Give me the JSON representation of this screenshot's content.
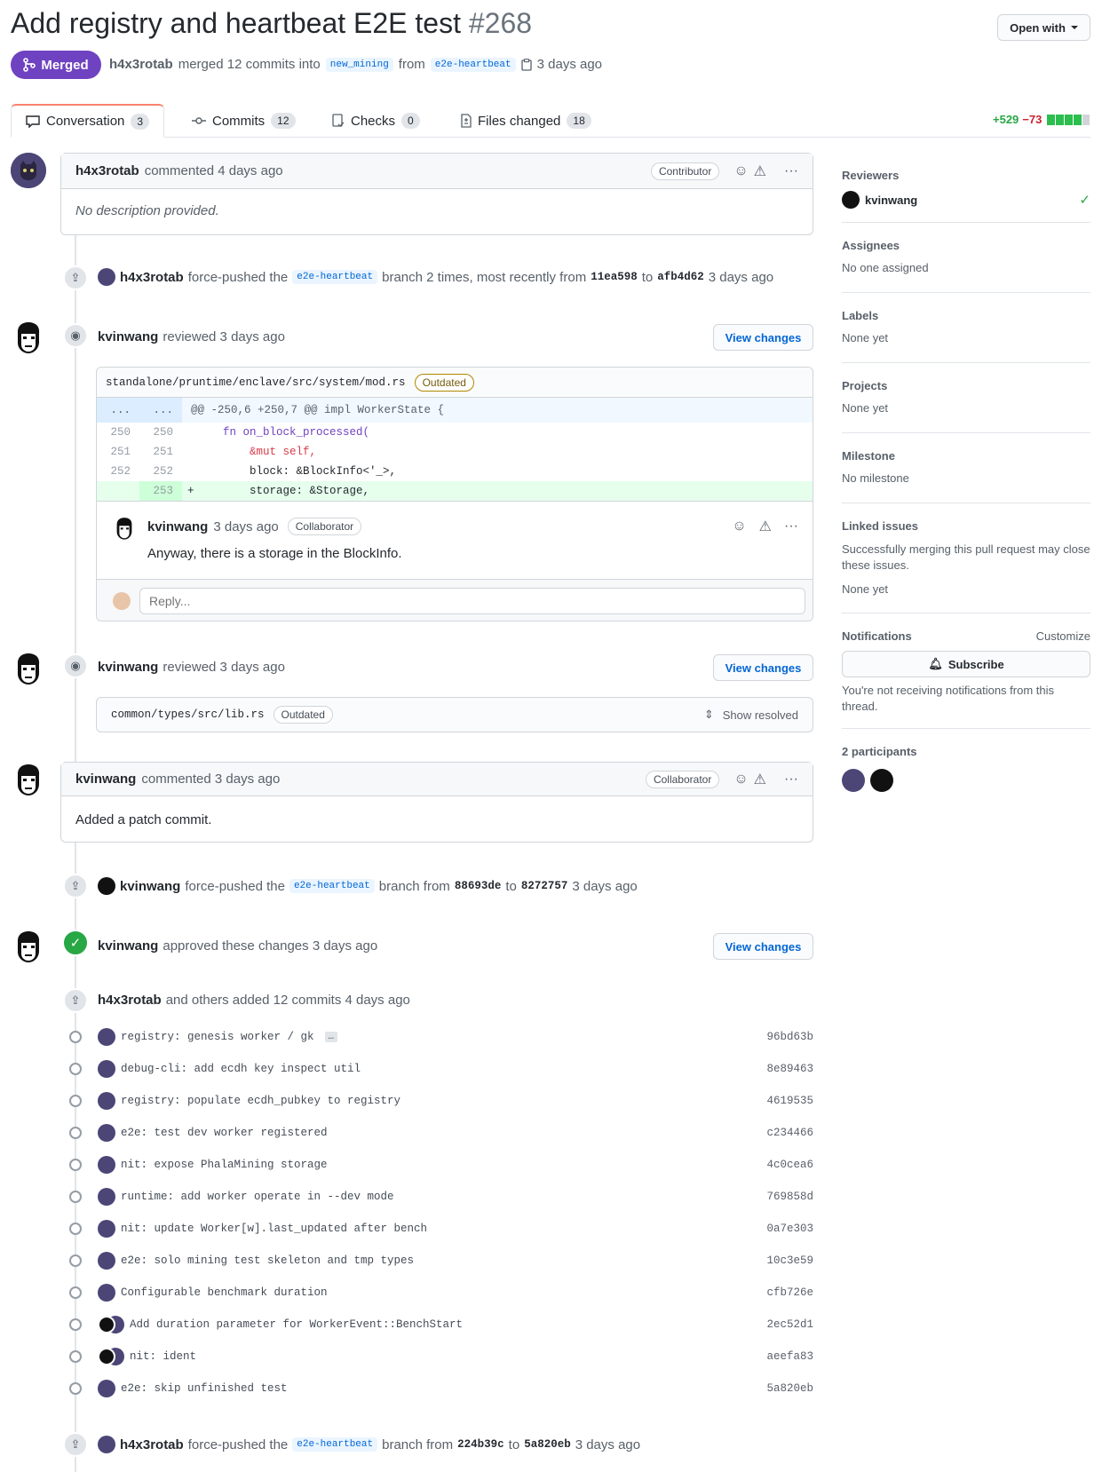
{
  "pr": {
    "title": "Add registry and heartbeat E2E test",
    "number": "#268",
    "state": "Merged",
    "author": "h4x3rotab",
    "merged_text": "merged 12 commits into",
    "base_branch": "new_mining",
    "from_text": "from",
    "head_branch": "e2e-heartbeat",
    "time": "3 days ago",
    "open_with": "Open with"
  },
  "tabs": [
    {
      "label": "Conversation",
      "count": "3"
    },
    {
      "label": "Commits",
      "count": "12"
    },
    {
      "label": "Checks",
      "count": "0"
    },
    {
      "label": "Files changed",
      "count": "18"
    }
  ],
  "diffstat": {
    "additions": "+529",
    "deletions": "−73"
  },
  "comment1": {
    "author": "h4x3rotab",
    "action": "commented 4 days ago",
    "role": "Contributor",
    "body": "No description provided."
  },
  "push1": {
    "author": "h4x3rotab",
    "pre": "force-pushed the",
    "branch": "e2e-heartbeat",
    "mid": "branch 2 times, most recently from",
    "from_sha": "11ea598",
    "to": "to",
    "to_sha": "afb4d62",
    "time": "3 days ago"
  },
  "review1": {
    "author": "kvinwang",
    "action": "reviewed 3 days ago",
    "view_changes": "View changes",
    "file": "standalone/pruntime/enclave/src/system/mod.rs",
    "outdated": "Outdated",
    "hunk": "@@ -250,6 +250,7 @@ impl WorkerState {",
    "dots": "...",
    "lines": [
      {
        "old": "250",
        "new": "250",
        "sign": "",
        "code": "    fn on_block_processed("
      },
      {
        "old": "251",
        "new": "251",
        "sign": "",
        "code": "        &mut self,"
      },
      {
        "old": "252",
        "new": "252",
        "sign": "",
        "code": "        block: &BlockInfo<'_>,"
      },
      {
        "old": "",
        "new": "253",
        "sign": "+",
        "code": "        storage: &Storage,"
      }
    ],
    "reply_author": "kvinwang",
    "reply_time": "3 days ago",
    "reply_role": "Collaborator",
    "reply_body": "Anyway, there is a storage in the BlockInfo.",
    "reply_placeholder": "Reply..."
  },
  "review2": {
    "author": "kvinwang",
    "action": "reviewed 3 days ago",
    "view_changes": "View changes",
    "file": "common/types/src/lib.rs",
    "outdated": "Outdated",
    "show_resolved": "Show resolved"
  },
  "comment2": {
    "author": "kvinwang",
    "action": "commented 3 days ago",
    "role": "Collaborator",
    "body": "Added a patch commit."
  },
  "push2": {
    "author": "kvinwang",
    "pre": "force-pushed the",
    "branch": "e2e-heartbeat",
    "mid": "branch from",
    "from_sha": "88693de",
    "to": "to",
    "to_sha": "8272757",
    "time": "3 days ago"
  },
  "approval": {
    "author": "kvinwang",
    "action": "approved these changes 3 days ago",
    "view_changes": "View changes"
  },
  "commits_header": {
    "author": "h4x3rotab",
    "text": "and others added 12 commits 4 days ago"
  },
  "commits": [
    {
      "msg": "registry: genesis worker / gk",
      "sha": "96bd63b",
      "more": "…",
      "dual": false
    },
    {
      "msg": "debug-cli: add ecdh key inspect util",
      "sha": "8e89463",
      "dual": false
    },
    {
      "msg": "registry: populate ecdh_pubkey to registry",
      "sha": "4619535",
      "dual": false
    },
    {
      "msg": "e2e: test dev worker registered",
      "sha": "c234466",
      "dual": false
    },
    {
      "msg": "nit: expose PhalaMining storage",
      "sha": "4c0cea6",
      "dual": false
    },
    {
      "msg": "runtime: add worker operate in --dev mode",
      "sha": "769858d",
      "dual": false
    },
    {
      "msg": "nit: update Worker[w].last_updated after bench",
      "sha": "0a7e303",
      "dual": false
    },
    {
      "msg": "e2e: solo mining test skeleton and tmp types",
      "sha": "10c3e59",
      "dual": false
    },
    {
      "msg": "Configurable benchmark duration",
      "sha": "cfb726e",
      "dual": false
    },
    {
      "msg": "Add duration parameter for WorkerEvent::BenchStart",
      "sha": "2ec52d1",
      "dual": true
    },
    {
      "msg": "nit: ident",
      "sha": "aeefa83",
      "dual": true
    },
    {
      "msg": "e2e: skip unfinished test",
      "sha": "5a820eb",
      "dual": false
    }
  ],
  "push3": {
    "author": "h4x3rotab",
    "pre": "force-pushed the",
    "branch": "e2e-heartbeat",
    "mid": "branch from",
    "from_sha": "224b39c",
    "to": "to",
    "to_sha": "5a820eb",
    "time": "3 days ago"
  },
  "sidebar": {
    "reviewers_h": "Reviewers",
    "reviewer": "kvinwang",
    "assignees_h": "Assignees",
    "assignees": "No one assigned",
    "labels_h": "Labels",
    "labels": "None yet",
    "projects_h": "Projects",
    "projects": "None yet",
    "milestone_h": "Milestone",
    "milestone": "No milestone",
    "linked_h": "Linked issues",
    "linked_desc": "Successfully merging this pull request may close these issues.",
    "linked": "None yet",
    "notifications_h": "Notifications",
    "customize": "Customize",
    "subscribe": "Subscribe",
    "notif_desc": "You're not receiving notifications from this thread.",
    "participants_h": "2 participants"
  },
  "colors": {
    "merged": "#6f42c1",
    "link": "#0366d6",
    "addition": "#28a745",
    "deletion": "#cb2431"
  }
}
